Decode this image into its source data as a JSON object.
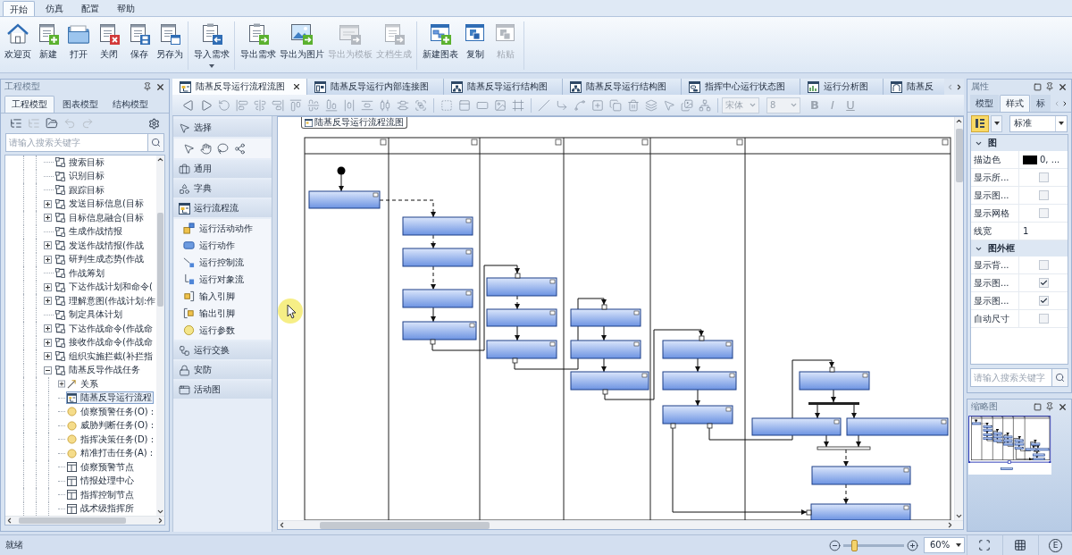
{
  "menu_tabs": [
    {
      "label": "开始",
      "selected": true
    },
    {
      "label": "仿真",
      "selected": false
    },
    {
      "label": "配置",
      "selected": false
    },
    {
      "label": "帮助",
      "selected": false
    }
  ],
  "ribbon_groups": [
    [
      {
        "label": "欢迎页",
        "kind": "home",
        "disabled": false,
        "dropdown": false
      },
      {
        "label": "新建",
        "kind": "new",
        "disabled": false,
        "dropdown": false
      },
      {
        "label": "打开",
        "kind": "open",
        "disabled": false,
        "dropdown": false
      },
      {
        "label": "关闭",
        "kind": "close",
        "disabled": false,
        "dropdown": false
      },
      {
        "label": "保存",
        "kind": "save",
        "disabled": false,
        "dropdown": false
      },
      {
        "label": "另存为",
        "kind": "save_as",
        "disabled": false,
        "dropdown": false
      }
    ],
    [
      {
        "label": "导入需求",
        "kind": "import",
        "disabled": false,
        "dropdown": true
      }
    ],
    [
      {
        "label": "导出需求",
        "kind": "export",
        "disabled": false,
        "dropdown": false
      },
      {
        "label": "导出为图片",
        "kind": "export_image",
        "disabled": false,
        "dropdown": false
      },
      {
        "label": "导出为模板",
        "kind": "export_template",
        "disabled": true,
        "dropdown": false
      },
      {
        "label": "文档生成",
        "kind": "document",
        "disabled": true,
        "dropdown": false
      }
    ],
    [
      {
        "label": "新建图表",
        "kind": "new_diagram",
        "disabled": false,
        "dropdown": false
      },
      {
        "label": "复制",
        "kind": "copy",
        "disabled": false,
        "dropdown": false
      },
      {
        "label": "粘贴",
        "kind": "paste",
        "disabled": true,
        "dropdown": false
      }
    ]
  ],
  "project_panel": {
    "title": "工程模型",
    "tabs": [
      {
        "label": "工程模型",
        "selected": true
      },
      {
        "label": "图表模型",
        "selected": false
      },
      {
        "label": "结构模型",
        "selected": false
      }
    ],
    "tools": [
      {
        "kind": "tree",
        "disabled": false
      },
      {
        "kind": "tree",
        "disabled": true
      },
      {
        "kind": "open",
        "disabled": false
      },
      {
        "kind": "undo",
        "disabled": true
      },
      {
        "kind": "redo",
        "disabled": true
      }
    ],
    "search": {
      "placeholder": "请输入搜索关键字"
    },
    "tree": [
      {
        "label": "搜索目标",
        "kind": "activity",
        "selected": false
      },
      {
        "label": "识别目标",
        "kind": "activity",
        "selected": false
      },
      {
        "label": "跟踪目标",
        "kind": "activity",
        "selected": false
      },
      {
        "label": "发送目标信息(目标",
        "kind": "activity",
        "selected": false,
        "expanded": false
      },
      {
        "label": "目标信息融合(目标",
        "kind": "activity",
        "selected": false,
        "expanded": false
      },
      {
        "label": "生成作战情报",
        "kind": "activity",
        "selected": false
      },
      {
        "label": "发送作战情报(作战",
        "kind": "activity",
        "selected": false,
        "expanded": false
      },
      {
        "label": "研判生成态势(作战",
        "kind": "activity",
        "selected": false,
        "expanded": false
      },
      {
        "label": "作战筹划",
        "kind": "activity",
        "selected": false
      },
      {
        "label": "下达作战计划和命令(",
        "kind": "activity",
        "selected": false,
        "expanded": false
      },
      {
        "label": "理解意图(作战计划:作",
        "kind": "activity",
        "selected": false,
        "expanded": false
      },
      {
        "label": "制定具体计划",
        "kind": "activity",
        "selected": false
      },
      {
        "label": "下达作战命令(作战命",
        "kind": "activity",
        "selected": false,
        "expanded": false
      },
      {
        "label": "接收作战命令(作战命",
        "kind": "activity",
        "selected": false,
        "expanded": false
      },
      {
        "label": "组织实施拦截(补拦指",
        "kind": "activity",
        "selected": false,
        "expanded": false
      },
      {
        "label": "陆基反导作战任务",
        "kind": "activity",
        "selected": false,
        "expanded": true,
        "children": [
          {
            "label": "关系",
            "kind": "relation",
            "selected": false,
            "expanded": false
          },
          {
            "label": "陆基反导运行流程",
            "kind": "diagram",
            "selected": true
          },
          {
            "label": "侦察预警任务(O) :",
            "kind": "parameter",
            "selected": false
          },
          {
            "label": "威胁判断任务(O) :",
            "kind": "parameter",
            "selected": false
          },
          {
            "label": "指挥决策任务(D) :",
            "kind": "parameter",
            "selected": false
          },
          {
            "label": "精准打击任务(A) :",
            "kind": "parameter",
            "selected": false
          },
          {
            "label": "侦察预警节点",
            "kind": "block",
            "selected": false
          },
          {
            "label": "情报处理中心",
            "kind": "block",
            "selected": false
          },
          {
            "label": "指挥控制节点",
            "kind": "block",
            "selected": false
          },
          {
            "label": "战术级指挥所",
            "kind": "block",
            "selected": false
          }
        ]
      }
    ]
  },
  "document_tabs": [
    {
      "label": "陆基反导运行流程流图",
      "kind": "flow",
      "selected": true
    },
    {
      "label": "陆基反导运行内部连接图",
      "kind": "internal",
      "selected": false
    },
    {
      "label": "陆基反导运行结构图",
      "kind": "structure",
      "selected": false
    },
    {
      "label": "陆基反导运行结构图",
      "kind": "structure",
      "selected": false
    },
    {
      "label": "指挥中心运行状态图",
      "kind": "state",
      "selected": false
    },
    {
      "label": "运行分析图",
      "kind": "analysis",
      "selected": false
    },
    {
      "label": "陆基反",
      "kind": "window",
      "selected": false
    }
  ],
  "diagram_toolbar": {
    "font": {
      "value": "宋体",
      "disabled": true
    },
    "size": {
      "value": "8",
      "disabled": true
    },
    "format_buttons": [
      {
        "label": "B",
        "kind": "bold",
        "disabled": true
      },
      {
        "label": "I",
        "kind": "italic",
        "disabled": true
      },
      {
        "label": "U",
        "kind": "underline",
        "disabled": true
      }
    ]
  },
  "toolbox": [
    {
      "label": "选择",
      "kind": "select"
    },
    {
      "label": "通用",
      "kind": "general"
    },
    {
      "label": "字典",
      "kind": "dictionary"
    },
    {
      "label": "运行流程流",
      "kind": "flow",
      "items": [
        {
          "label": "运行活动动作",
          "kind": "activity_action"
        },
        {
          "label": "运行动作",
          "kind": "action"
        },
        {
          "label": "运行控制流",
          "kind": "control_flow"
        },
        {
          "label": "运行对象流",
          "kind": "object_flow"
        },
        {
          "label": "输入引脚",
          "kind": "input_pin"
        },
        {
          "label": "输出引脚",
          "kind": "output_pin"
        },
        {
          "label": "运行参数",
          "kind": "parameter"
        }
      ]
    },
    {
      "label": "运行交换",
      "kind": "exchange"
    },
    {
      "label": "安防",
      "kind": "security"
    },
    {
      "label": "活动图",
      "kind": "activity"
    }
  ],
  "canvas": {
    "breadcrumb": "陆基反导运行流程流图"
  },
  "properties_panel": {
    "title": "属性",
    "tabs": [
      {
        "label": "模型",
        "selected": false
      },
      {
        "label": "样式",
        "selected": true
      },
      {
        "label": "标",
        "selected": false
      }
    ],
    "style_preset": "标准",
    "categories": [
      {
        "label": "图",
        "expanded": true,
        "rows": [
          {
            "name": "描边色",
            "kind": "color",
            "color": "#000000",
            "value": "0, ..."
          },
          {
            "name": "显示所...",
            "kind": "checkbox",
            "checked": false
          },
          {
            "name": "显示图...",
            "kind": "checkbox",
            "checked": false
          },
          {
            "name": "显示网格",
            "kind": "checkbox",
            "checked": false
          },
          {
            "name": "线宽",
            "kind": "text",
            "value": "1"
          }
        ]
      },
      {
        "label": "图外框",
        "expanded": true,
        "rows": [
          {
            "name": "显示背...",
            "kind": "checkbox",
            "checked": false
          },
          {
            "name": "显示图...",
            "kind": "checkbox",
            "checked": true
          },
          {
            "name": "显示图...",
            "kind": "checkbox",
            "checked": true
          },
          {
            "name": "自动尺寸",
            "kind": "checkbox",
            "checked": false
          }
        ]
      }
    ],
    "search": {
      "placeholder": "请输入搜索关键字"
    }
  },
  "thumbnail_panel": {
    "title": "缩略图"
  },
  "status_bar": {
    "text": "就绪",
    "zoom": {
      "level": 0.18,
      "value": "60%"
    },
    "view_buttons": [
      {
        "kind": "fit"
      },
      {
        "kind": "grid"
      },
      {
        "kind": "text",
        "label": "E"
      }
    ]
  }
}
